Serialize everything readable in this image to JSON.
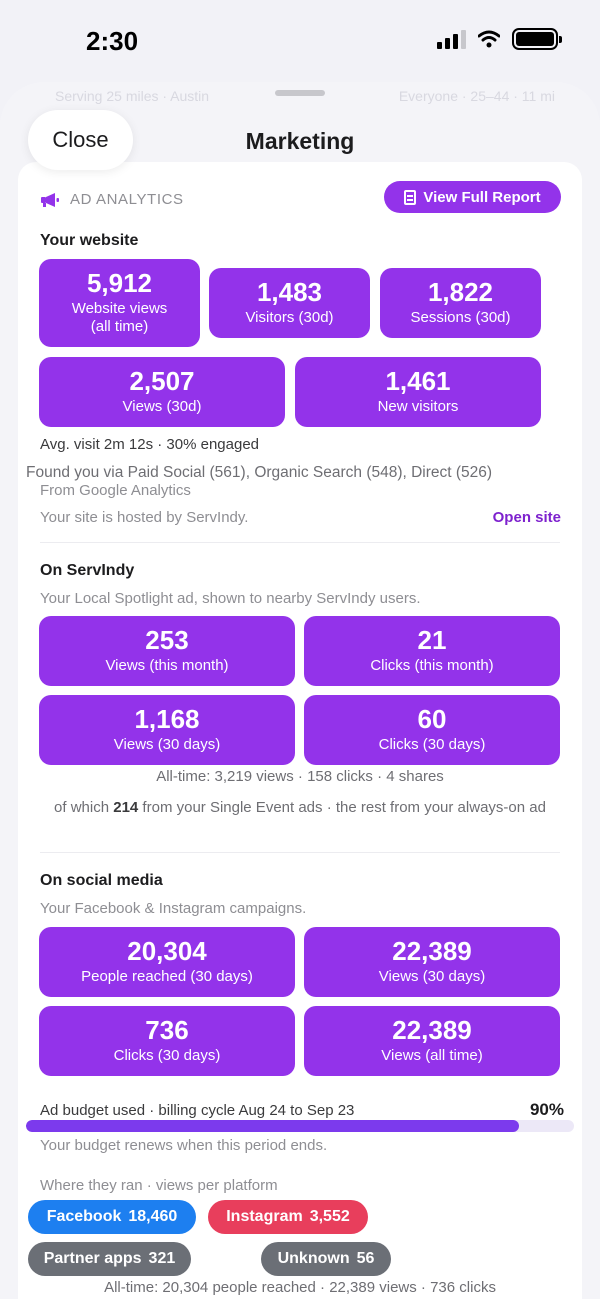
{
  "status_bar": {
    "time": "2:30"
  },
  "sheet": {
    "ghost_left": "Serving 25 miles · Austin",
    "ghost_right": "Everyone · 25–44 · 11 mi",
    "close_label": "Close",
    "title": "Marketing"
  },
  "ad_analytics": {
    "section_label": "AD ANALYTICS",
    "report_button": "View Full Report"
  },
  "website": {
    "heading": "Your website",
    "tiles": [
      {
        "value": "5,912",
        "label": "Website views\n(all time)"
      },
      {
        "value": "1,483",
        "label": "Visitors (30d)"
      },
      {
        "value": "1,822",
        "label": "Sessions (30d)"
      },
      {
        "value": "2,507",
        "label": "Views (30d)"
      },
      {
        "value": "1,461",
        "label": "New visitors"
      }
    ],
    "avg_visit": "Avg. visit 2m 12s · 30% engaged",
    "found_via": "Found you via Paid Social (561), Organic Search (548), Direct (526)",
    "source": "From Google Analytics",
    "hosted": "Your site is hosted by ServIndy.",
    "open_site": "Open site"
  },
  "servindy": {
    "heading": "On ServIndy",
    "subtitle": "Your Local Spotlight ad, shown to nearby ServIndy users.",
    "tiles": [
      {
        "value": "253",
        "label": "Views (this month)"
      },
      {
        "value": "21",
        "label": "Clicks (this month)"
      },
      {
        "value": "1,168",
        "label": "Views (30 days)"
      },
      {
        "value": "60",
        "label": "Clicks (30 days)"
      }
    ],
    "all_time": "All-time: 3,219 views · 158 clicks · 4 shares",
    "note_prefix": "of which ",
    "note_bold": "214",
    "note_suffix": " from your Single Event ads · the rest from your always-on ad"
  },
  "social": {
    "heading": "On social media",
    "subtitle": "Your Facebook & Instagram campaigns.",
    "tiles": [
      {
        "value": "20,304",
        "label": "People reached (30 days)"
      },
      {
        "value": "22,389",
        "label": "Views (30 days)"
      },
      {
        "value": "736",
        "label": "Clicks (30 days)"
      },
      {
        "value": "22,389",
        "label": "Views (all time)"
      }
    ],
    "budget_label": "Ad budget used · billing cycle Aug 24 to Sep 23",
    "budget_percent": "90%",
    "budget_fraction": 0.9,
    "budget_note": "Your budget renews when this period ends.",
    "platforms_label": "Where they ran · views per platform",
    "platforms": [
      {
        "name": "Facebook",
        "count": "18,460",
        "color": "#1d7ff0"
      },
      {
        "name": "Instagram",
        "count": "3,552",
        "color": "#e83e5c"
      },
      {
        "name": "Partner apps",
        "count": "321",
        "color": "#6b6f76"
      },
      {
        "name": "Unknown",
        "count": "56",
        "color": "#6b6f76"
      }
    ],
    "all_time": "All-time: 20,304 people reached · 22,389 views · 736 clicks"
  },
  "colors": {
    "accent": "#9333ea",
    "progress": "#7c3aed",
    "link": "#7e22ce"
  }
}
